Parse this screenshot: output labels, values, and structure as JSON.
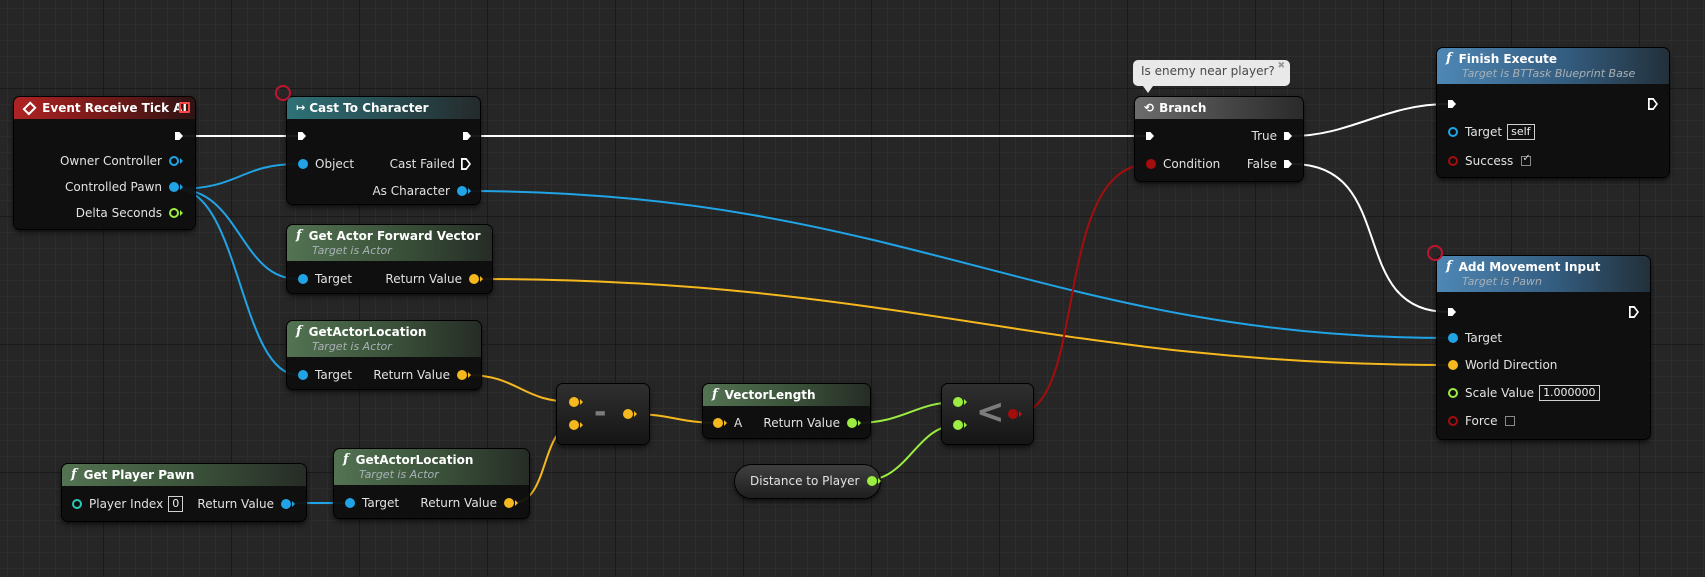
{
  "comment": {
    "text": "Is enemy near player?"
  },
  "nodes": {
    "event_tick": {
      "title": "Event Receive Tick AI",
      "pins": [
        "Owner Controller",
        "Controlled Pawn",
        "Delta Seconds"
      ]
    },
    "cast": {
      "title": "Cast To Character",
      "object": "Object",
      "cast_failed": "Cast Failed",
      "as_character": "As Character"
    },
    "forward_vector": {
      "title": "Get Actor Forward Vector",
      "subtitle": "Target is Actor",
      "target": "Target",
      "return_value": "Return Value"
    },
    "actor_location_1": {
      "title": "GetActorLocation",
      "subtitle": "Target is Actor",
      "target": "Target",
      "return_value": "Return Value"
    },
    "subtract": {
      "symbol": "-"
    },
    "vector_length": {
      "title": "VectorLength",
      "a": "A",
      "return_value": "Return Value"
    },
    "less_than": {
      "symbol": "<"
    },
    "distance_var": {
      "name": "Distance to Player"
    },
    "get_player_pawn": {
      "title": "Get Player Pawn",
      "player_index": "Player Index",
      "player_index_value": "0",
      "return_value": "Return Value"
    },
    "actor_location_2": {
      "title": "GetActorLocation",
      "subtitle": "Target is Actor",
      "target": "Target",
      "return_value": "Return Value"
    },
    "branch": {
      "title": "Branch",
      "condition": "Condition",
      "true_label": "True",
      "false_label": "False"
    },
    "finish_execute": {
      "title": "Finish Execute",
      "subtitle": "Target is BTTask Blueprint Base",
      "target": "Target",
      "target_value": "self",
      "success": "Success",
      "success_checked": true
    },
    "add_movement": {
      "title": "Add Movement Input",
      "subtitle": "Target is Pawn",
      "target": "Target",
      "world_direction": "World Direction",
      "scale_value": "Scale Value",
      "scale_value_value": "1.000000",
      "force": "Force",
      "force_checked": false
    }
  },
  "colors": {
    "exec_wire": "#ffffff",
    "object_pin": "#21a4e6",
    "vector_pin": "#f5b81e",
    "float_pin": "#9ced41",
    "bool_pin": "#a40d0d",
    "breakpoint": "#c3142f"
  }
}
